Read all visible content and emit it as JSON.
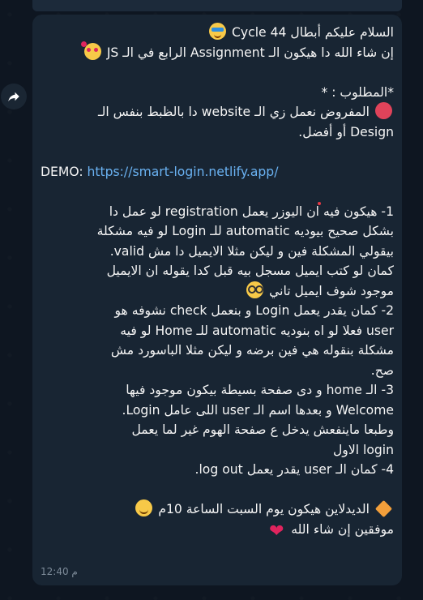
{
  "message": {
    "lines": [
      "السلام عليكم أبطال Cycle 44",
      "إن شاء الله دا هيكون الـ Assignment الرابع في الـ JS",
      "",
      "*المطلوب : *",
      "المفروض نعمل زي الـ website دا بالظبط بنفس الـ",
      "Design أو أفضل.",
      "",
      "DEMO:",
      "",
      "1- هيكون فيه ان اليوزر يعمل registration لو عمل دا",
      "بشكل صحيح بيوديه automatic للـ Login لو فيه مشكلة",
      "بيقولي المشكلة فين و ليكن مثلا الايميل دا مش valid.",
      "كمان لو كتب ايميل مسجل بيه قبل كدا يقوله ان الايميل",
      "موجود شوف ايميل تاني",
      "2- كمان يقدر يعمل Login و بنعمل check نشوفه هو",
      "user فعلا لو اه بنوديه automatic للـ Home لو فيه",
      "مشكلة بنقوله هي فين برضه و ليكن مثلا الباسورد مش",
      "صح.",
      "3- الـ home و دى صفحة بسيطة بيكون موجود فيها",
      "Welcome و بعدها اسم الـ user اللى عامل Login.",
      "وطبعا ماينفعش يدخل ع صفحة الهوم غير لما يعمل",
      "login الاول",
      "4- كمان الـ user يقدر يعمل log out.",
      "",
      "الديدلاين هيكون يوم السبت الساعة 10م",
      "موفقين إن شاء الله"
    ],
    "demo_link": "https://smart-login.netlify.app/",
    "time": "12:40",
    "time_suffix": "م"
  },
  "emoji": {
    "line1": "star-struck",
    "line2": "smiling-face-with-hearts",
    "line5": "red-circle",
    "line14": "nerd-face",
    "line25_start": "orange-diamond",
    "line25_end": "smiling-face",
    "line26": "red-heart"
  },
  "colors": {
    "background": "#0e1621",
    "bubble": "#182533",
    "text": "#f5f5f5",
    "link": "#6ab2f2",
    "meta": "#7d8b99"
  }
}
